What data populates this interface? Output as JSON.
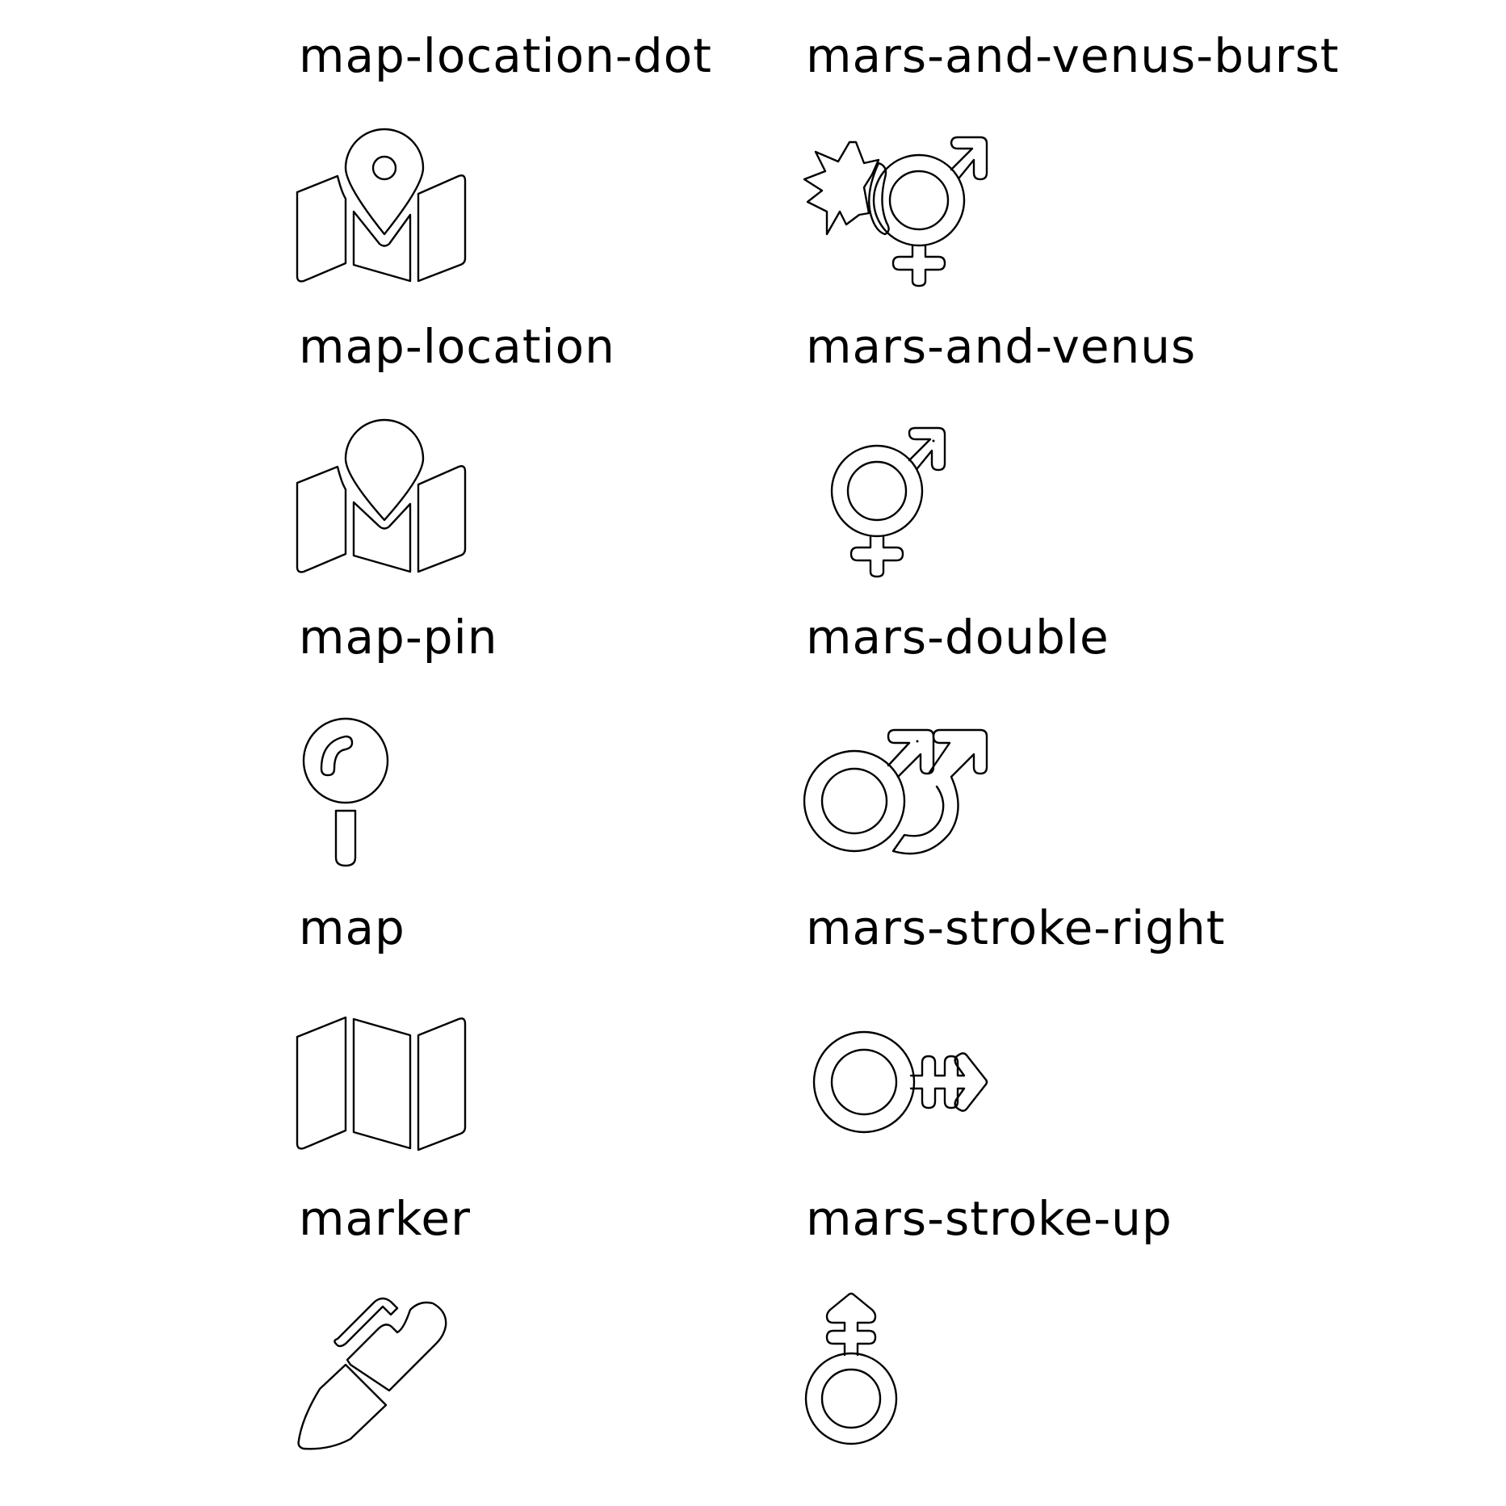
{
  "icon_sheet": {
    "left_column": [
      {
        "label": "map-location-dot",
        "icon": "map-location-dot-icon"
      },
      {
        "label": "map-location",
        "icon": "map-location-icon"
      },
      {
        "label": "map-pin",
        "icon": "map-pin-icon"
      },
      {
        "label": "map",
        "icon": "map-icon"
      },
      {
        "label": "marker",
        "icon": "marker-icon"
      }
    ],
    "right_column": [
      {
        "label": "mars-and-venus-burst",
        "icon": "mars-and-venus-burst-icon"
      },
      {
        "label": "mars-and-venus",
        "icon": "mars-and-venus-icon"
      },
      {
        "label": "mars-double",
        "icon": "mars-double-icon"
      },
      {
        "label": "mars-stroke-right",
        "icon": "mars-stroke-right-icon"
      },
      {
        "label": "mars-stroke-up",
        "icon": "mars-stroke-up-icon"
      }
    ],
    "colors": {
      "ink": "#000000",
      "background": "#ffffff"
    }
  }
}
